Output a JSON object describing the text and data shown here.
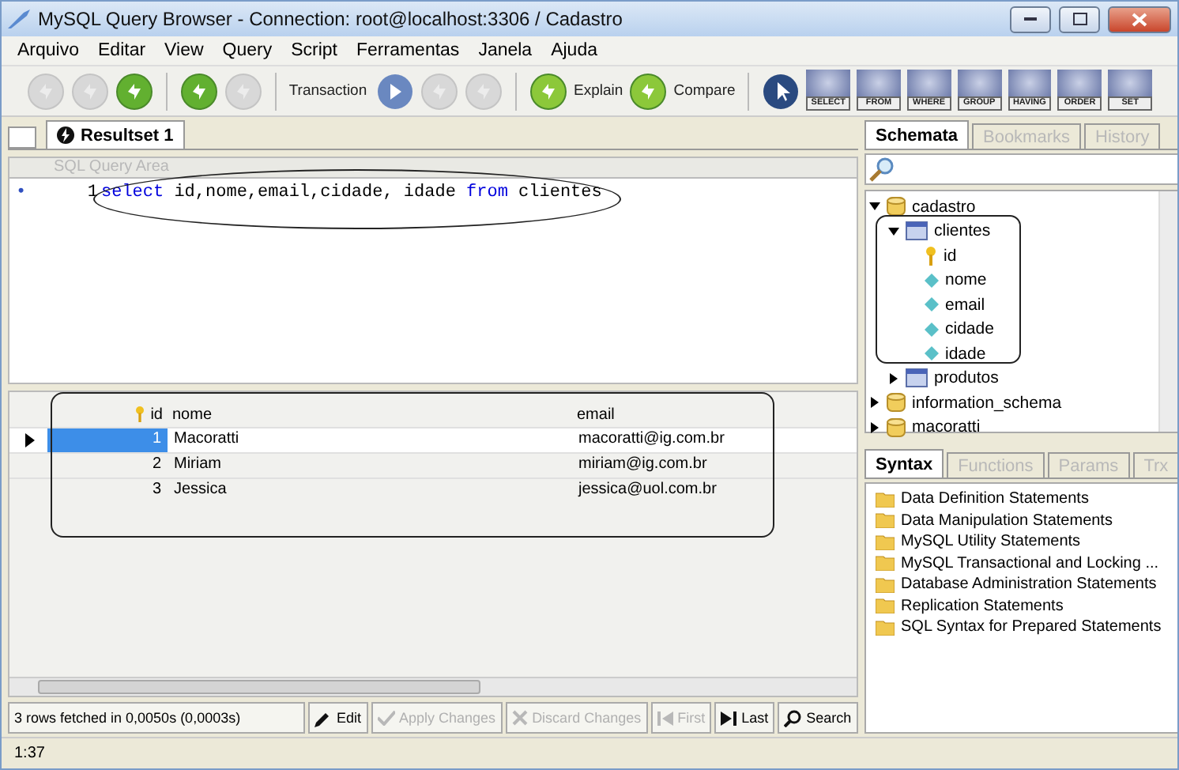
{
  "window": {
    "title": "MySQL Query Browser - Connection: root@localhost:3306 / Cadastro"
  },
  "menu": [
    {
      "label": "Arquivo"
    },
    {
      "label": "Editar"
    },
    {
      "label": "View"
    },
    {
      "label": "Query"
    },
    {
      "label": "Script"
    },
    {
      "label": "Ferramentas"
    },
    {
      "label": "Janela"
    },
    {
      "label": "Ajuda"
    }
  ],
  "toolbar": [
    {
      "kind": "round",
      "disabled": true
    },
    {
      "kind": "round",
      "disabled": true
    },
    {
      "kind": "round",
      "disabled": false
    },
    {
      "kind": "separator"
    },
    {
      "kind": "round",
      "disabled": false
    },
    {
      "kind": "round",
      "disabled": true
    },
    {
      "kind": "separator"
    },
    {
      "kind": "text",
      "label": "Transaction"
    },
    {
      "kind": "blue",
      "disabled": false
    },
    {
      "kind": "round",
      "disabled": true
    },
    {
      "kind": "round",
      "disabled": true
    },
    {
      "kind": "separator"
    },
    {
      "kind": "round",
      "disabled": false,
      "label": "Explain"
    },
    {
      "kind": "round",
      "disabled": false,
      "label": "Compare"
    },
    {
      "kind": "separator"
    },
    {
      "kind": "pointer",
      "disabled": false
    },
    {
      "kind": "clause",
      "label": "SELECT"
    },
    {
      "kind": "clause",
      "label": "FROM"
    },
    {
      "kind": "clause",
      "label": "WHERE"
    },
    {
      "kind": "clause",
      "label": "GROUP"
    },
    {
      "kind": "clause",
      "label": "HAVING"
    },
    {
      "kind": "clause",
      "label": "ORDER"
    },
    {
      "kind": "clause",
      "label": "SET"
    }
  ],
  "query_tabs": [
    {
      "label": "Resultset 1",
      "selected": true
    }
  ],
  "editor": {
    "header": "SQL Query Area",
    "marker": "•",
    "line_number": "1",
    "tokens": [
      {
        "text": "select",
        "kind": "keyword"
      },
      {
        "text": " id,nome,email,cidade, idade ",
        "kind": "plain"
      },
      {
        "text": "from",
        "kind": "keyword"
      },
      {
        "text": " clientes",
        "kind": "plain"
      }
    ]
  },
  "results": {
    "columns": [
      "id",
      "nome",
      "email"
    ],
    "rows": [
      {
        "cells": [
          "1",
          "Macoratti",
          "macoratti@ig.com.br"
        ],
        "selected": true
      },
      {
        "cells": [
          "2",
          "Miriam",
          "miriam@ig.com.br"
        ],
        "selected": false
      },
      {
        "cells": [
          "3",
          "Jessica",
          "jessica@uol.com.br"
        ],
        "selected": false
      }
    ]
  },
  "result_bar": {
    "status": "3 rows fetched in 0,0050s (0,0003s)",
    "buttons": [
      {
        "label": "Edit",
        "kind": "pencil",
        "disabled": false
      },
      {
        "label": "Apply Changes",
        "kind": "check",
        "disabled": true
      },
      {
        "label": "Discard Changes",
        "kind": "cross",
        "disabled": true
      },
      {
        "label": "First",
        "kind": "first",
        "disabled": true
      },
      {
        "label": "Last",
        "kind": "last",
        "disabled": false
      },
      {
        "label": "Search",
        "kind": "search",
        "disabled": false
      }
    ]
  },
  "schema_tabs": [
    {
      "label": "Schemata",
      "selected": true
    },
    {
      "label": "Bookmarks",
      "selected": false
    },
    {
      "label": "History",
      "selected": false
    }
  ],
  "schema_tree": [
    {
      "label": "cadastro",
      "kind": "database",
      "expanded": true,
      "children": [
        {
          "label": "clientes",
          "kind": "table",
          "expanded": true,
          "children": [
            {
              "label": "id",
              "kind": "key"
            },
            {
              "label": "nome",
              "kind": "column"
            },
            {
              "label": "email",
              "kind": "column"
            },
            {
              "label": "cidade",
              "kind": "column"
            },
            {
              "label": "idade",
              "kind": "column"
            }
          ]
        },
        {
          "label": "produtos",
          "kind": "table",
          "expanded": false
        }
      ]
    },
    {
      "label": "information_schema",
      "kind": "database",
      "expanded": false
    },
    {
      "label": "macoratti",
      "kind": "database",
      "expanded": false
    }
  ],
  "syntax_tabs": [
    {
      "label": "Syntax",
      "selected": true
    },
    {
      "label": "Functions",
      "selected": false
    },
    {
      "label": "Params",
      "selected": false
    },
    {
      "label": "Trx",
      "selected": false
    }
  ],
  "syntax_items": [
    "Data Definition Statements",
    "Data Manipulation Statements",
    "MySQL Utility Statements",
    "MySQL Transactional and Locking ...",
    "Database Administration Statements",
    "Replication Statements",
    "SQL Syntax for Prepared Statements"
  ],
  "status_bar": {
    "position": "1:37"
  }
}
